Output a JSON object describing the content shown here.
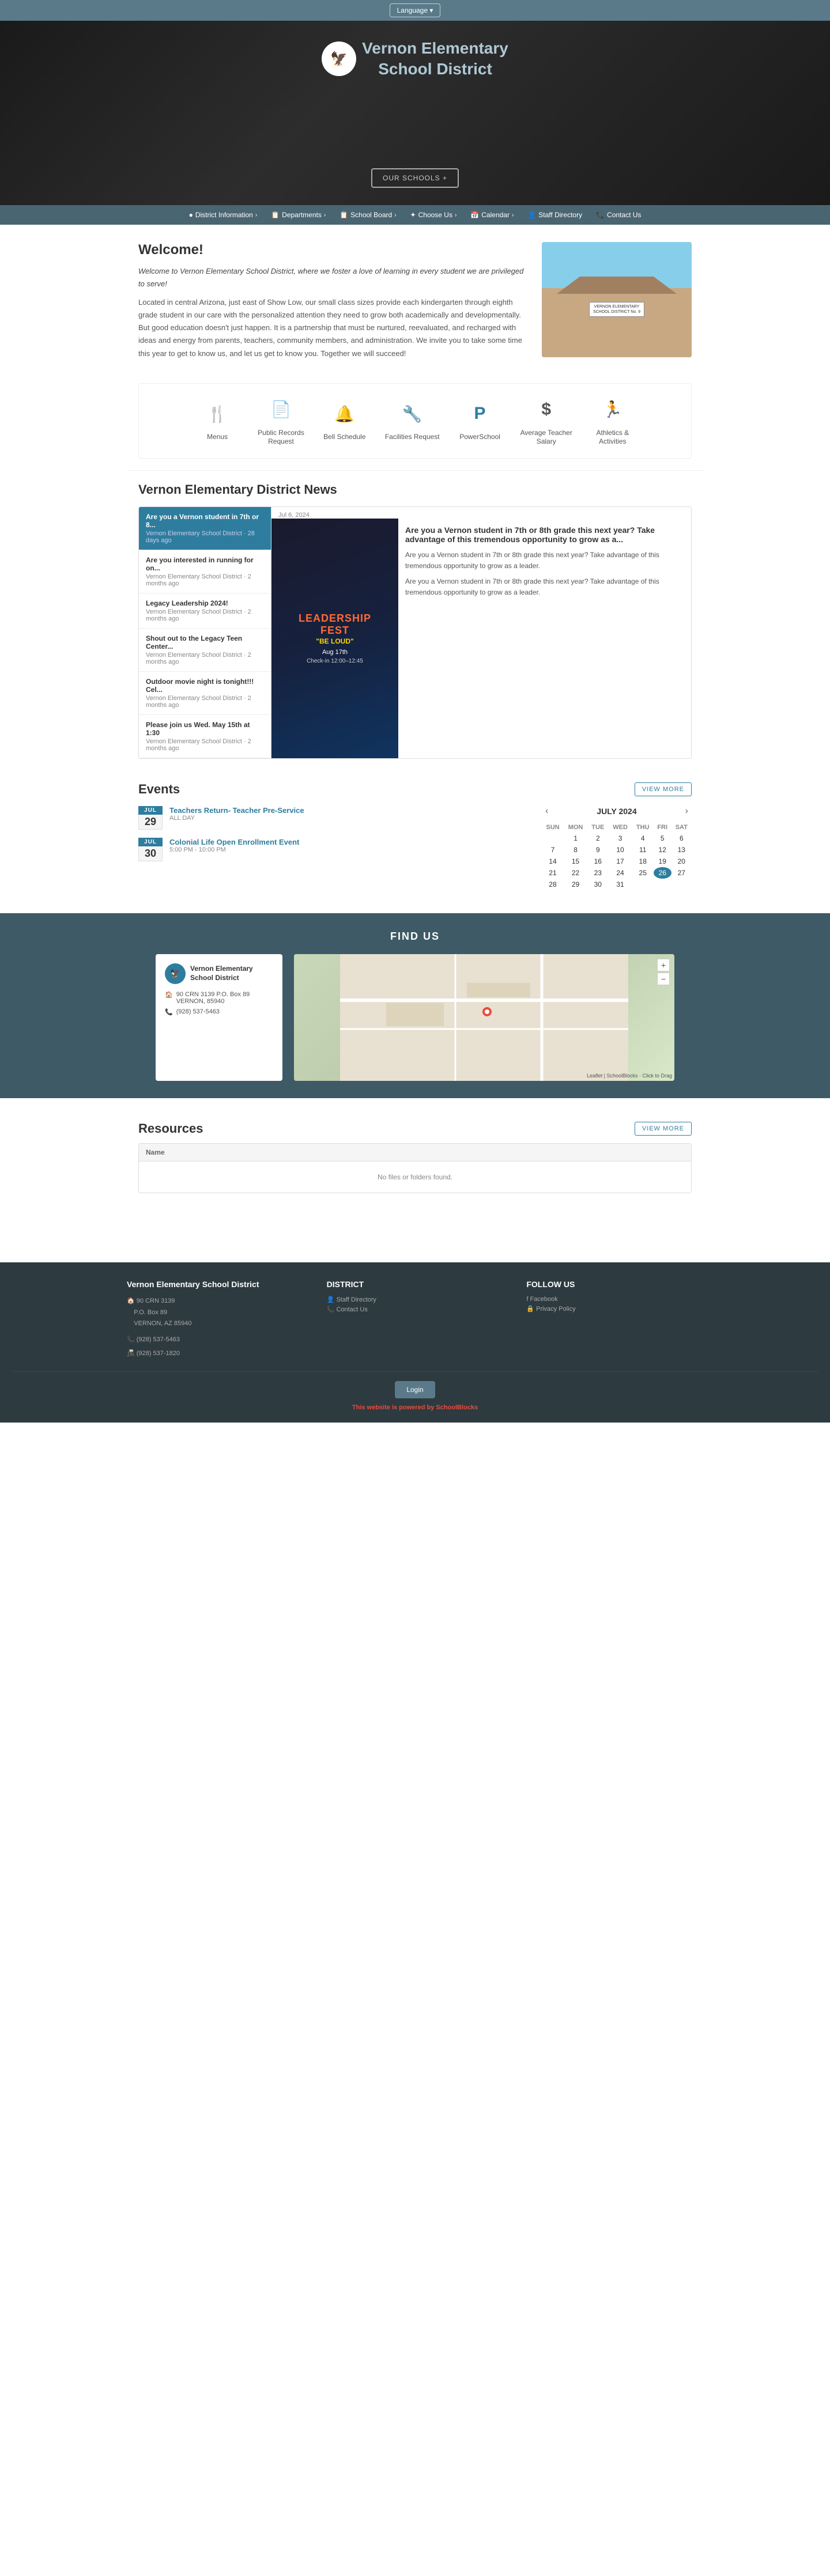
{
  "language_bar": {
    "button_label": "Language ▾"
  },
  "hero": {
    "logo_emoji": "🦅",
    "title_line1": "Vernon Elementary",
    "title_line2": "School District",
    "schools_btn": "OUR SCHOOLS +"
  },
  "nav": {
    "items": [
      {
        "label": "District Information",
        "has_chevron": true
      },
      {
        "label": "Departments",
        "has_chevron": true
      },
      {
        "label": "School Board",
        "has_chevron": true
      },
      {
        "label": "Choose Us",
        "has_chevron": true
      },
      {
        "label": "Calendar",
        "has_chevron": true
      },
      {
        "label": "Staff Directory"
      },
      {
        "label": "Contact Us"
      }
    ]
  },
  "welcome": {
    "heading": "Welcome!",
    "para1": "Welcome to Vernon Elementary School District, where we foster a love of learning in every student we are privileged to serve!",
    "para2": "Located in central Arizona, just east of Show Low, our small class sizes provide each kindergarten through eighth grade student in our care with the personalized attention they need to grow both academically and developmentally. But good education doesn't just happen. It is a partnership that must be nurtured, reevaluated, and recharged with ideas and energy from parents, teachers, community members, and administration. We invite you to take some time this year to get to know us, and let us get to know you. Together we will succeed!",
    "image_alt": "Vernon Elementary School District Building"
  },
  "quick_links": {
    "items": [
      {
        "icon": "🍴",
        "label": "Menus"
      },
      {
        "icon": "📄",
        "label": "Public Records\nRequest"
      },
      {
        "icon": "🔔",
        "label": "Bell Schedule"
      },
      {
        "icon": "🔧",
        "label": "Facilities Request"
      },
      {
        "icon": "🅿",
        "label": "PowerSchool"
      },
      {
        "icon": "$",
        "label": "Average Teacher\nSalary"
      },
      {
        "icon": "🏃",
        "label": "Athletics &\nActivities"
      }
    ]
  },
  "news": {
    "heading": "Vernon Elementary District News",
    "items": [
      {
        "title": "Are you a Vernon student in 7th or 8...",
        "meta": "Vernon Elementary School District · 28 days ago",
        "active": true
      },
      {
        "title": "Are you interested in running for on...",
        "meta": "Vernon Elementary School District · 2 months ago",
        "active": false
      },
      {
        "title": "Legacy Leadership 2024!",
        "meta": "Vernon Elementary School District · 2 months ago",
        "active": false
      },
      {
        "title": "Shout out to the Legacy Teen Center...",
        "meta": "Vernon Elementary School District · 2 months ago",
        "active": false
      },
      {
        "title": "Outdoor movie night is tonight!!! Cel...",
        "meta": "Vernon Elementary School District · 2 months ago",
        "active": false
      },
      {
        "title": "Please join us Wed. May 15th at 1:30",
        "meta": "Vernon Elementary School District · 2 months ago",
        "active": false
      }
    ],
    "detail": {
      "date": "Jul 6, 2024",
      "image_alt": "Leadership Fest - Be Loud",
      "heading": "Are you a Vernon student in 7th or 8th grade this next year? Take advantage of this tremendous opportunity to grow as a...",
      "para1": "Are you a Vernon student in 7th or 8th grade this next year? Take advantage of this tremendous opportunity to grow as a leader.",
      "para2": "Are you a Vernon student in 7th or 8th grade this next year? Take advantage of this tremendous opportunity to grow as a leader."
    }
  },
  "events": {
    "heading": "Events",
    "view_more_btn": "VIEW MORE",
    "items": [
      {
        "month": "JUL",
        "day": "29",
        "title": "Teachers Return- Teacher Pre-Service",
        "time": "ALL DAY"
      },
      {
        "month": "JUL",
        "day": "30",
        "title": "Colonial Life Open Enrollment Event",
        "time": "5:00 PM - 10:00 PM"
      }
    ],
    "calendar": {
      "month": "JULY 2024",
      "headers": [
        "SUN",
        "MON",
        "TUE",
        "WED",
        "THU",
        "FRI",
        "SAT"
      ],
      "weeks": [
        [
          "",
          "1",
          "2",
          "3",
          "4",
          "5",
          "6"
        ],
        [
          "7",
          "8",
          "9",
          "10",
          "11",
          "12",
          "13"
        ],
        [
          "14",
          "15",
          "16",
          "17",
          "18",
          "19",
          "20"
        ],
        [
          "21",
          "22",
          "23",
          "24",
          "25",
          "26",
          "27"
        ],
        [
          "28",
          "29",
          "30",
          "31",
          "",
          "",
          ""
        ]
      ],
      "today": "26"
    }
  },
  "find_us": {
    "heading": "FIND US",
    "org_name": "Vernon Elementary\nSchool District",
    "address_icon": "🏠",
    "address": "90 CRN 3139 P.O. Box 89 VERNON, 85940",
    "phone_icon": "📞",
    "phone": "(928) 537-5463",
    "map_attribution": "Leaflet | SchoolBlocks · Click to Drag",
    "zoom_in": "+",
    "zoom_out": "−"
  },
  "resources": {
    "heading": "Resources",
    "view_more_btn": "VIEW MORE",
    "table_header": "Name",
    "empty_message": "No files or folders found."
  },
  "footer": {
    "col1": {
      "heading": "Vernon Elementary School District",
      "address_icon": "🏠",
      "address_line1": "90 CRN 3139",
      "address_line2": "P.O. Box 89",
      "address_line3": "VERNON, AZ 85940",
      "phone_icon": "📞",
      "phone": "(928) 537-5463",
      "fax_icon": "📠",
      "fax": "(928) 537-1820"
    },
    "col2": {
      "heading": "DISTRICT",
      "links": [
        {
          "icon": "👤",
          "label": "Staff Directory"
        },
        {
          "icon": "📞",
          "label": "Contact Us"
        }
      ]
    },
    "col3": {
      "heading": "FOLLOW US",
      "links": [
        {
          "icon": "f",
          "label": "Facebook"
        },
        {
          "icon": "🔒",
          "label": "Privacy Policy"
        }
      ]
    },
    "login_btn": "Login",
    "powered_by_text": "This website is powered by ",
    "powered_by_brand": "SchoolBlocks"
  }
}
